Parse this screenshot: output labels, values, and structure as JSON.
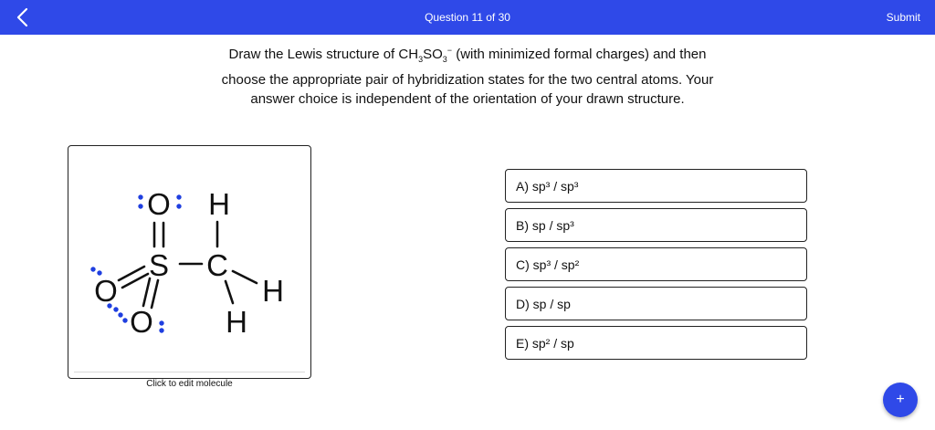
{
  "header": {
    "title": "Question 11 of 30",
    "submit_label": "Submit",
    "back_icon": "chevron-left-icon"
  },
  "question": {
    "line1_pre": "Draw the Lewis structure of CH",
    "sub1": "3",
    "mid": "SO",
    "sub2": "3",
    "sup": "−",
    "line1_post": " (with minimized formal charges) and then choose the appropriate pair of hybridization states for the two central atoms. Your answer choice is independent of the orientation of your drawn structure."
  },
  "molecule": {
    "caption": "Click to edit molecule",
    "atoms": {
      "o_top": "O",
      "o_left": "O",
      "o_bottom": "O",
      "s": "S",
      "c": "C",
      "h_top": "H",
      "h_right": "H",
      "h_bottom": "H"
    },
    "lone_pair_color": "#1f3fe0"
  },
  "choices": [
    {
      "label": "A) sp³ / sp³"
    },
    {
      "label": "B) sp / sp³"
    },
    {
      "label": "C) sp³ / sp²"
    },
    {
      "label": "D) sp / sp"
    },
    {
      "label": "E) sp² / sp"
    }
  ],
  "fab": {
    "label": "+"
  },
  "colors": {
    "accent": "#2f49e8",
    "text": "#111111"
  }
}
